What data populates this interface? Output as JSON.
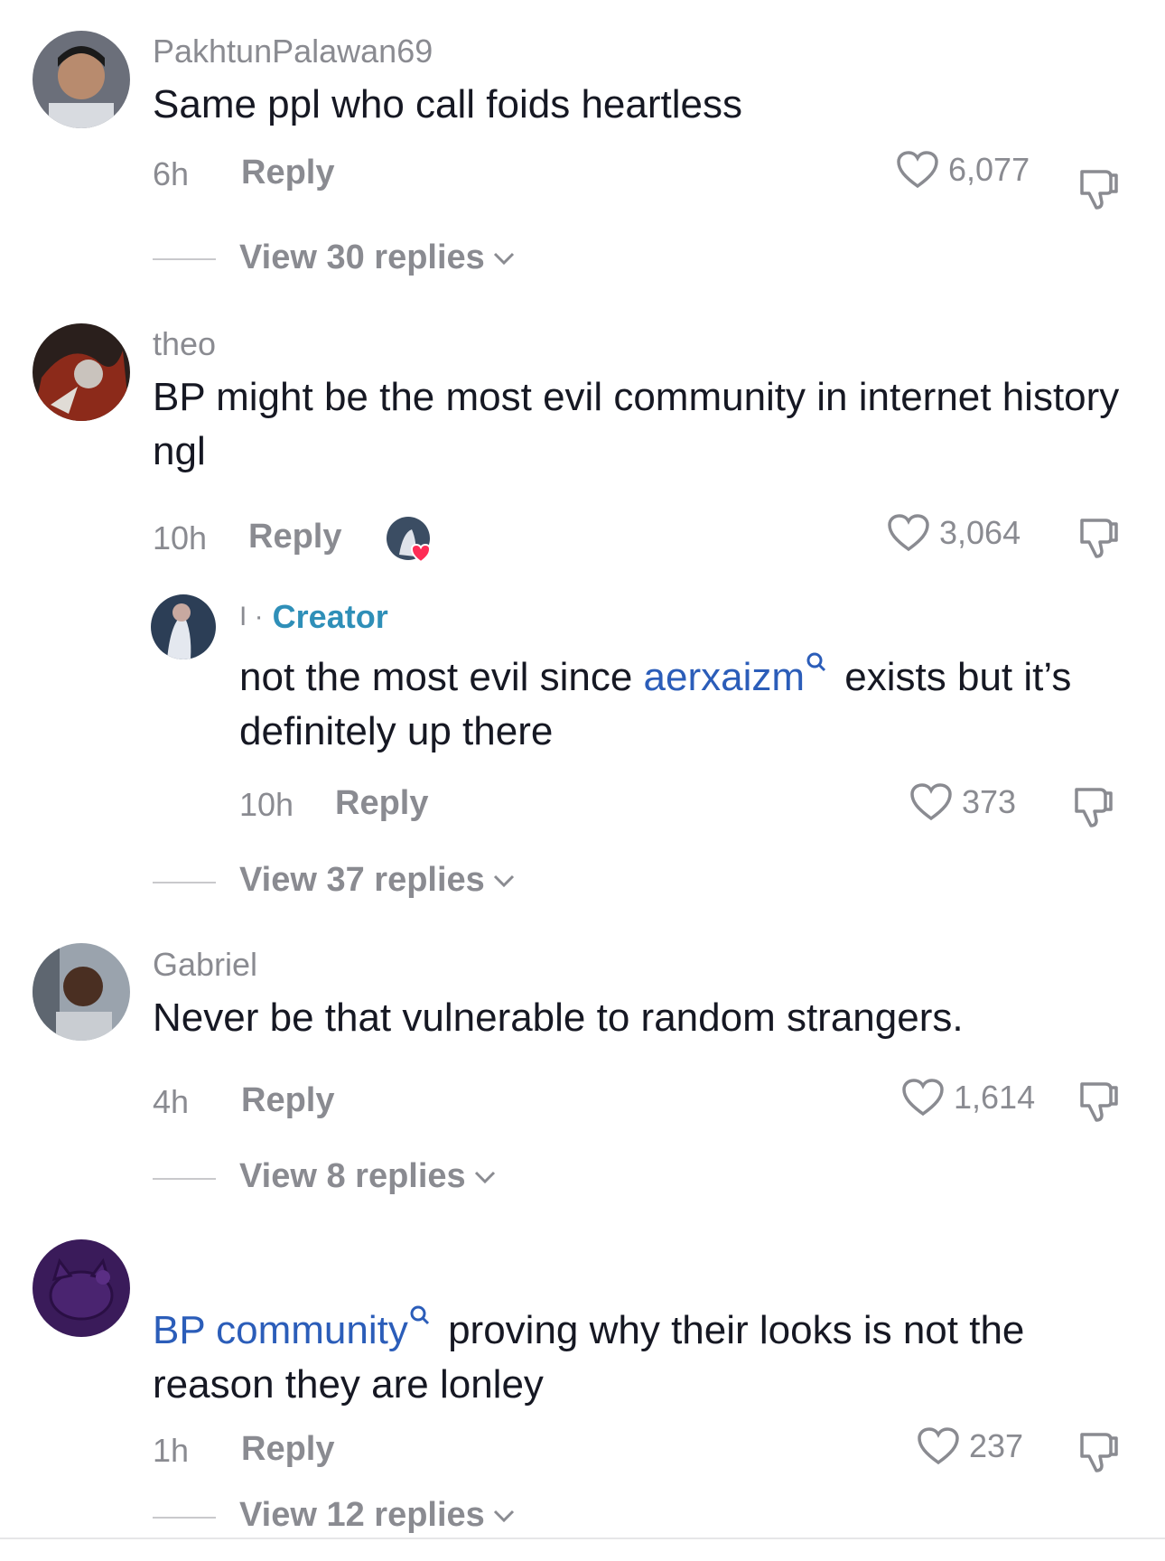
{
  "comments": [
    {
      "username": "PakhtunPalawan69",
      "text": "Same ppl who call foids heartless",
      "time": "6h",
      "reply": "Reply",
      "likes": "6,077",
      "view_replies": "View 30 replies"
    },
    {
      "username": "theo",
      "text": "BP might be the most evil community in internet history ngl",
      "time": "10h",
      "reply": "Reply",
      "likes": "3,064",
      "creator_reply": {
        "prefix": "I ·",
        "badge": "Creator",
        "text_before": "not the most evil since ",
        "tag": "aerxaizm",
        "text_after": " exists but it’s definitely up there",
        "time": "10h",
        "reply": "Reply",
        "likes": "373"
      },
      "view_replies": "View 37 replies"
    },
    {
      "username": "Gabriel",
      "text": "Never be that vulnerable to random strangers.",
      "time": "4h",
      "reply": "Reply",
      "likes": "1,614",
      "view_replies": "View 8 replies"
    },
    {
      "username": "",
      "tag": "BP community",
      "text_after": " proving why their looks is not the reason they are lonley",
      "time": "1h",
      "reply": "Reply",
      "likes": "237",
      "view_replies": "View 12 replies"
    }
  ],
  "icons": {
    "like": "heart-outline-icon",
    "dislike": "thumbs-down-outline-icon",
    "expand": "chevron-down-icon",
    "tag": "search-icon"
  },
  "colors": {
    "text": "#161823",
    "muted": "#8a8b91",
    "tag": "#2b5db9",
    "creator": "#2f8fb8",
    "heart_badge": "#fe2c55"
  }
}
